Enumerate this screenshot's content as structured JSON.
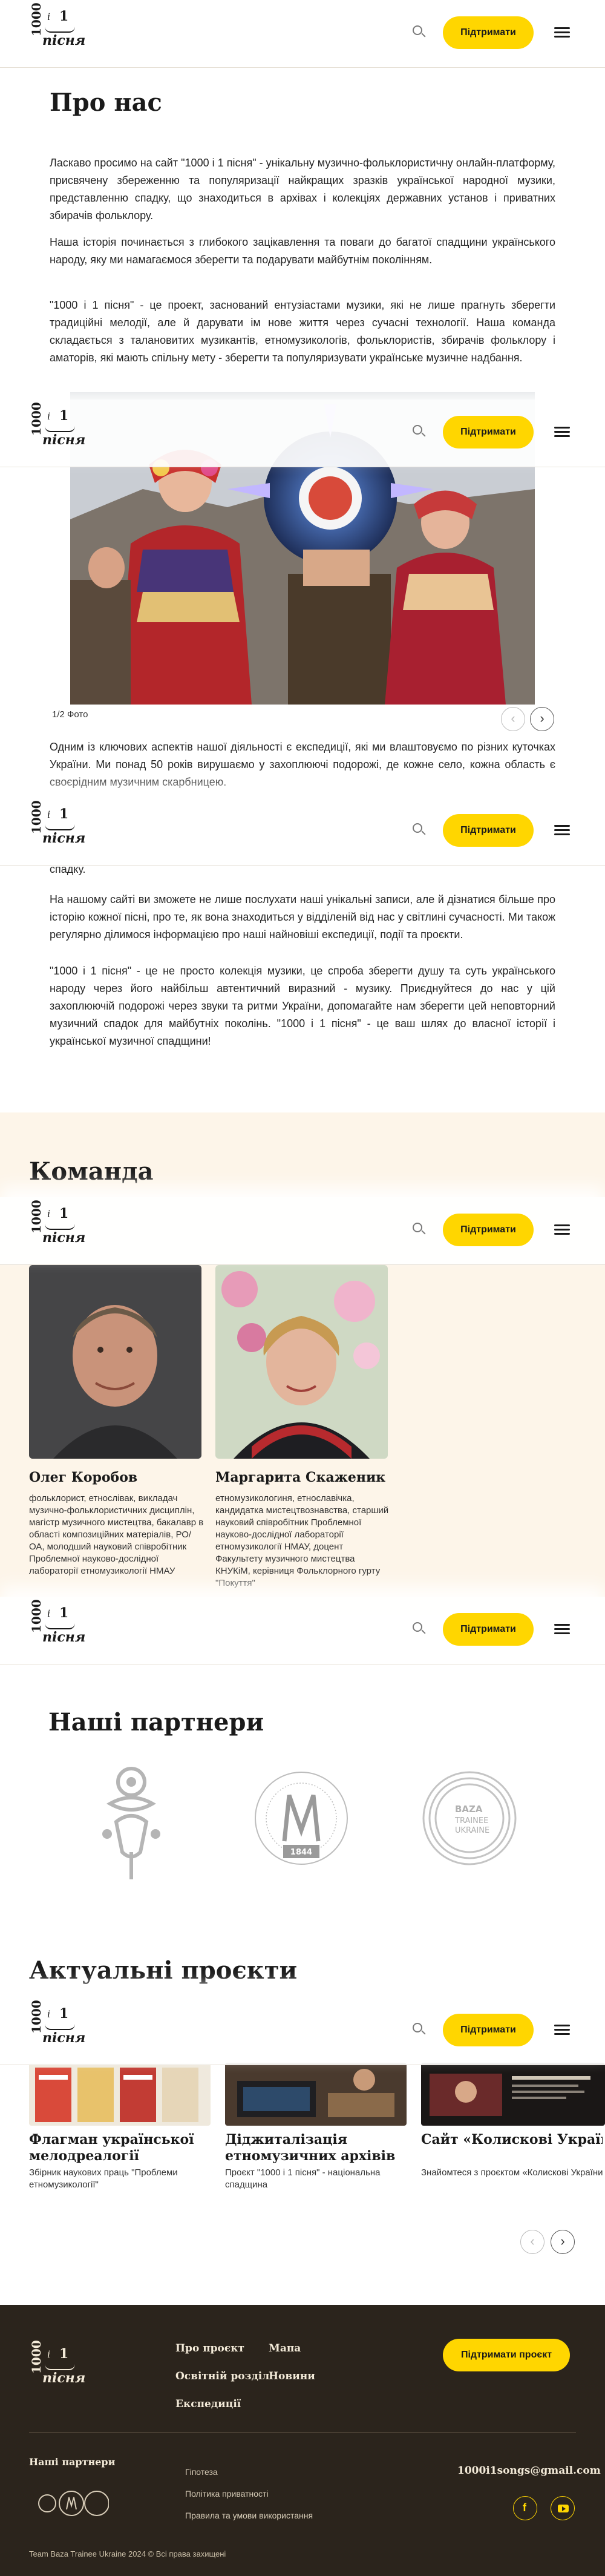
{
  "header": {
    "logo_top": "1000",
    "logo_i": "і",
    "logo_one": "1",
    "logo_bottom": "пісня",
    "support_label": "Підтримати"
  },
  "about": {
    "title": "Про нас",
    "p1": "Ласкаво просимо на сайт \"1000 і 1 пісня\" - унікальну музично-фольклористичну онлайн-платформу, присвячену збереженню та популяризації найкращих зразків української народної музики, представленню спадку, що знаходиться в архівах і колекціях державних установ і приватних збирачів фольклору.",
    "p2": "Наша історія починається з глибокого зацікавлення та поваги до багатої спадщини українського народу, яку ми намагаємося зберегти та подарувати майбутнім поколінням.",
    "p3": "\"1000 і 1 пісня\" - це проект, заснований ентузіастами музики, які не лише прагнуть зберегти традиційні мелодії, але й дарувати ім нове життя через сучасні технології. Наша команда складається з талановитих музикантів, етномузикологів, фольклористів, збирачів фольклору і аматорів, які мають спільну мету - зберегти та популяризувати українське музичне надбання.",
    "photo_caption": "1/2 Фото",
    "p4": "Одним із ключових аспектів нашої діяльності є експедиції, які ми влаштовуємо по різних куточках України. Ми понад 50 років вирушаємо у захоплюючі подорожі, де кожне село, кожна область є своєрідним музичним скарбницею.",
    "p4_tail": "спадку.",
    "p5": "На нашому сайті ви зможете не лише послухати наші унікальні записи, але й дізнатися більше про історію кожної пісні, про те, як вона знаходиться у відділеній від нас у світлині сучасності. Ми також регулярно ділимося інформацією про наші найновіші експедиції, події та проєкти.",
    "p6": "\"1000 і 1 пісня\" - це не просто колекція музики, це спроба зберегти душу та суть українського народу через його найбільш автентичний виразний - музику. Приєднуйтеся до нас у цій захоплюючій подорожі через звуки та ритми України, допомагайте нам зберегти цей неповторний музичний спадок для майбутніх поколінь. \"1000 і 1 пісня\" - це ваш шлях до власної історії і української музичної спадщини!"
  },
  "team": {
    "title": "Команда",
    "members": [
      {
        "name": "Олег Коробов",
        "desc": "фольклорист, етнослівак, викладач музично-фольклористичних дисциплін, магістр музичного мистецтва, бакалавр в області композиційних матеріалів, РО/ОА, молодший науковий співробітник Проблемної науково-дослідної лабораторії етномузикології НМАУ"
      },
      {
        "name": "Маргарита Скаженик",
        "desc": "етномузикологиня, етнославічка, кандидатка мистецтвознавства, старший науковий співробітник Проблемної науково-дослідної лабораторії етномузикології НМАУ, доцент Факультету музичного мистецтва КНУКіМ, керівниця Фольклорного гурту \"Покуття\""
      }
    ]
  },
  "partners": {
    "title": "Наші партнери",
    "baza_logo_text_1": "BAZA",
    "baza_logo_text_2": "TRAINEE",
    "baza_logo_text_3": "UKRAINE",
    "academy_year": "1844"
  },
  "projects": {
    "title": "Актуальні проєкти",
    "items": [
      {
        "title": "Флагман української мелодреалогії",
        "desc": "Збірник наукових праць \"Проблеми етномузикології\""
      },
      {
        "title": "Діджиталізація етномузичних архівів",
        "desc": "Проєкт \"1000 і 1 пісня\" - національна спадщина"
      },
      {
        "title": "Сайт «Колискові України»: пісенний гайд для мам",
        "desc": "Знайомтеся з проєктом «Колискові України»"
      }
    ]
  },
  "footer": {
    "nav": [
      "Про проєкт",
      "Мапа",
      "Освітній розділ",
      "Новини",
      "Експедиції"
    ],
    "support_project_label": "Підтримати проєкт",
    "partners_label": "Наші партнери",
    "links": [
      "Гіпотеза",
      "Політика приватності",
      "Правила та умови використання"
    ],
    "email": "1000i1songs@gmail.com",
    "copyright": "Team Baza Trainee Ukraine 2024 © Всі права захищені"
  },
  "colors": {
    "accent": "#ffd600",
    "team_bg": "#fdf5e9",
    "footer_bg": "#2b241c"
  }
}
